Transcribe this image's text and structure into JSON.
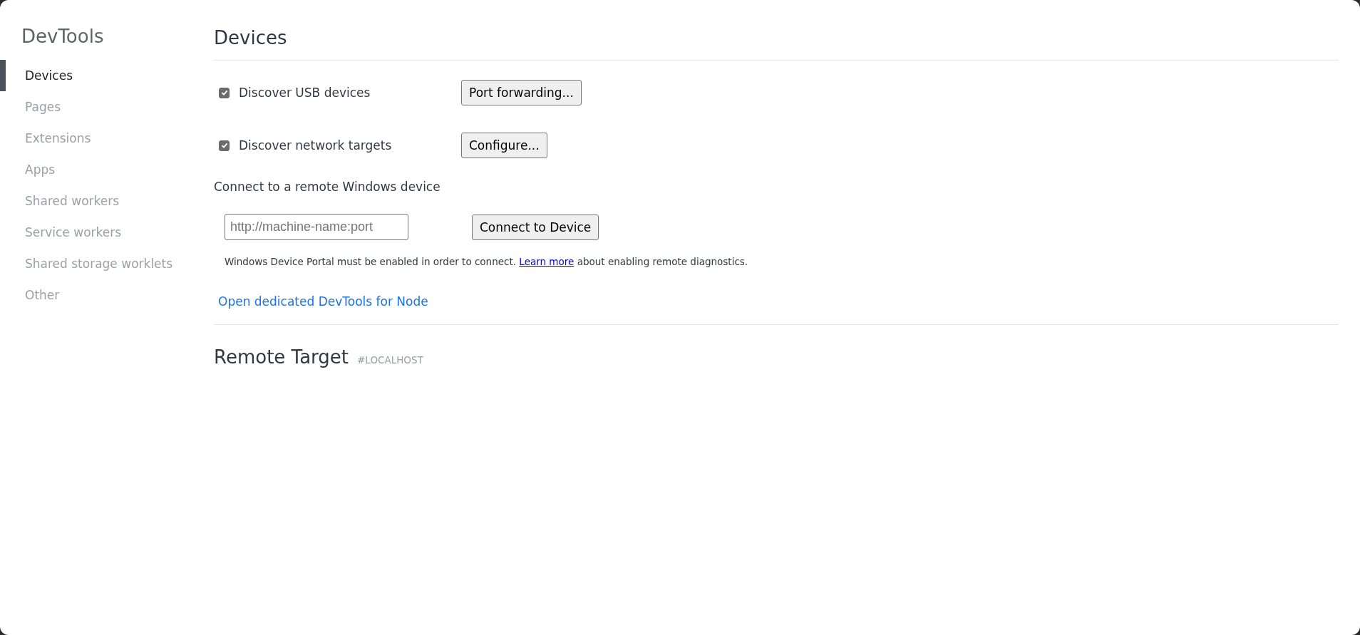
{
  "sidebar": {
    "title": "DevTools",
    "items": [
      {
        "label": "Devices",
        "selected": true
      },
      {
        "label": "Pages",
        "selected": false
      },
      {
        "label": "Extensions",
        "selected": false
      },
      {
        "label": "Apps",
        "selected": false
      },
      {
        "label": "Shared workers",
        "selected": false
      },
      {
        "label": "Service workers",
        "selected": false
      },
      {
        "label": "Shared storage worklets",
        "selected": false
      },
      {
        "label": "Other",
        "selected": false
      }
    ]
  },
  "devices": {
    "title": "Devices",
    "options": [
      {
        "label": "Discover USB devices",
        "checked": true,
        "button": "Port forwarding..."
      },
      {
        "label": "Discover network targets",
        "checked": true,
        "button": "Configure..."
      }
    ],
    "remote_windows": {
      "heading": "Connect to a remote Windows device",
      "placeholder": "http://machine-name:port",
      "button": "Connect to Device",
      "note_before": "Windows Device Portal must be enabled in order to connect.",
      "note_link": "Learn more",
      "note_after": "about enabling remote diagnostics."
    },
    "node_link": "Open dedicated DevTools for Node"
  },
  "remote_target": {
    "title": "Remote Target",
    "host": "#LOCALHOST"
  }
}
